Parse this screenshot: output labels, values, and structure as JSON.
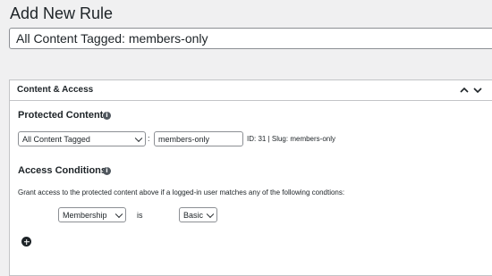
{
  "page": {
    "title": "Add New Rule"
  },
  "rule_title": {
    "value": "All Content Tagged: members-only"
  },
  "metabox": {
    "title": "Content & Access",
    "protected_content": {
      "heading": "Protected Content",
      "type_select": "All Content Tagged",
      "separator": ":",
      "tag_value": "members-only",
      "tag_info": "ID: 31 | Slug: members-only"
    },
    "access_conditions": {
      "heading": "Access Conditions",
      "description": "Grant access to the protected content above if a logged-in user matches any of the following condtions:",
      "condition_type": "Membership",
      "operator": "is",
      "condition_value": "Basic"
    }
  },
  "icons": {
    "info": "info-icon",
    "collapse_up": "chevron-up-icon",
    "collapse_down": "chevron-down-icon",
    "add": "plus-circle-icon"
  }
}
